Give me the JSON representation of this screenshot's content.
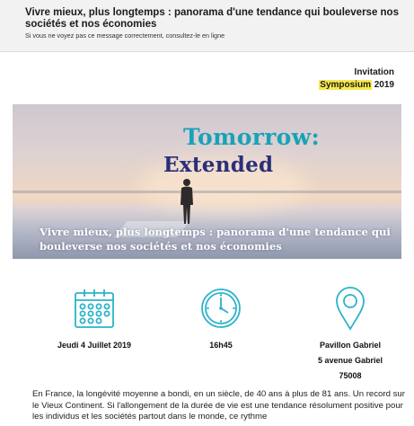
{
  "preheader": {
    "subject": "Vivre mieux, plus longtemps : panorama d'une tendance qui bouleverse nos sociétés et nos économies",
    "view_prefix": "Si vous ne voyez pas ce message correctement,",
    "view_link": "consultez-le en ligne"
  },
  "invitation": {
    "label": "Invitation",
    "event_highlight": "Symposium",
    "year": "2019"
  },
  "hero": {
    "title_line1": "Tomorrow:",
    "title_line2": "Extended",
    "tagline": "Vivre mieux, plus longtemps : panorama d'une tendance qui bouleverse nos sociétés et nos économies",
    "colors": {
      "accent_teal": "#18a2b8",
      "accent_navy": "#2a2f79"
    }
  },
  "details": {
    "date": "Jeudi 4 Juillet 2019",
    "time": "16h45",
    "place_lines": [
      "Pavillon Gabriel",
      "5 avenue Gabriel",
      "75008"
    ],
    "icons": [
      "calendar-icon",
      "clock-icon",
      "location-pin-icon"
    ],
    "icon_color": "#2bb3c9"
  },
  "body": {
    "paragraph": "En France, la longévité moyenne a bondi, en un siècle, de 40 ans à plus de 81 ans. Un record sur le Vieux Continent. Si l'allongement de la durée de vie est une tendance résolument positive pour les individus et les sociétés partout dans le monde, ce rythme"
  }
}
